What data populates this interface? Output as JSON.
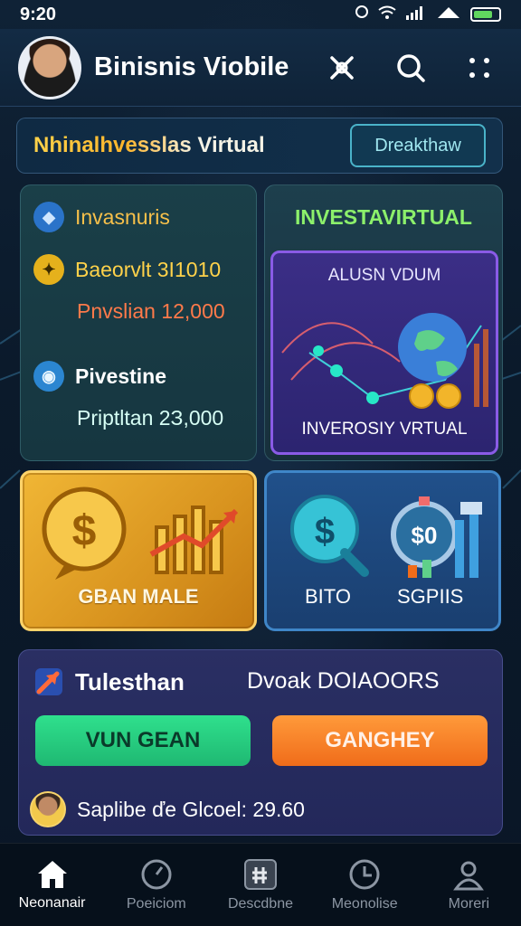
{
  "status_bar": {
    "time": "9:20"
  },
  "header": {
    "title": "Binisnis Viobile",
    "actions": [
      "crossed-tools-icon",
      "search-icon",
      "more-icon"
    ]
  },
  "banner": {
    "title": "Nhinalhvesslas Virtual",
    "button_label": "Dreakthaw"
  },
  "stats_card": {
    "rows": [
      {
        "label": "Invasnuris",
        "icon": "diamond-icon",
        "color": "#f7c04a"
      },
      {
        "label": "Baeorvlt 3I1010",
        "icon": "gear-icon",
        "color": "#ffd24a"
      },
      {
        "label": "Pnvslian 12,000",
        "icon": "",
        "color": "#ff7a4a"
      },
      {
        "label": "Pivestine",
        "icon": "coin-icon",
        "color": "#ffffff"
      },
      {
        "label": "Priptltan 2З,000",
        "icon": "",
        "color": "#d7fff5"
      }
    ]
  },
  "virtual_card": {
    "title": "INVESTAVIRTUAL",
    "inner_top": "ALUSN VDUM",
    "inner_bottom": "INVEROSIY VRTUAL"
  },
  "gold_card": {
    "label": "GBAN MALE"
  },
  "blue_card": {
    "label_left": "BITO",
    "label_right": "SGPIIS"
  },
  "bottom_card": {
    "title": "Tulesthan",
    "right_text": "Dvoak DOIAOORS",
    "green_button": "VUN GEAN",
    "orange_button": "GANGHEY",
    "footer_text": "Saplibe ďe Glcoel: 29.60"
  },
  "bottom_nav": [
    {
      "label": "Neonanair",
      "icon": "home-icon",
      "active": true
    },
    {
      "label": "Poeiciom",
      "icon": "gauge-icon",
      "active": false
    },
    {
      "label": "Descdbne",
      "icon": "badge-icon",
      "active": false
    },
    {
      "label": "Meonolise",
      "icon": "clock-icon",
      "active": false
    },
    {
      "label": "Moreri",
      "icon": "user-icon",
      "active": false
    }
  ],
  "colors": {
    "accent_gold": "#f0b635",
    "accent_green": "#2fe08d",
    "accent_orange": "#f06c1a",
    "accent_purple": "#8a5be6"
  }
}
